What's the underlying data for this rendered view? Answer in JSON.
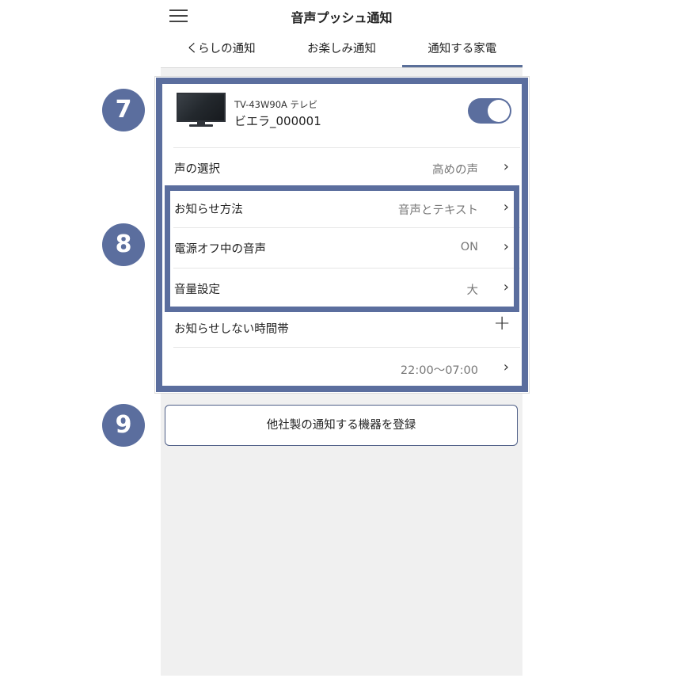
{
  "header": {
    "title": "音声プッシュ通知",
    "menu_icon": "hamburger-menu-icon",
    "tabs": [
      {
        "label": "くらしの通知",
        "active": false
      },
      {
        "label": "お楽しみ通知",
        "active": false
      },
      {
        "label": "通知する家電",
        "active": true
      }
    ]
  },
  "device": {
    "icon": "tv-icon",
    "model": "TV-43W90A テレビ",
    "name": "ビエラ_000001",
    "toggle_on": true
  },
  "settings": [
    {
      "label": "声の選択",
      "value": "高めの声"
    },
    {
      "label": "お知らせ方法",
      "value": "音声とテキスト"
    },
    {
      "label": "電源オフ中の音声",
      "value": "ON"
    },
    {
      "label": "音量設定",
      "value": "大"
    },
    {
      "label": "お知らせしない時間帯",
      "value": ""
    },
    {
      "label": "",
      "value": "22:00〜07:00"
    }
  ],
  "register_button": "他社製の通知する機器を登録",
  "badges": [
    "7",
    "8",
    "9"
  ],
  "colors": {
    "accent": "#5b6e9e",
    "background": "#f0f0f0"
  }
}
